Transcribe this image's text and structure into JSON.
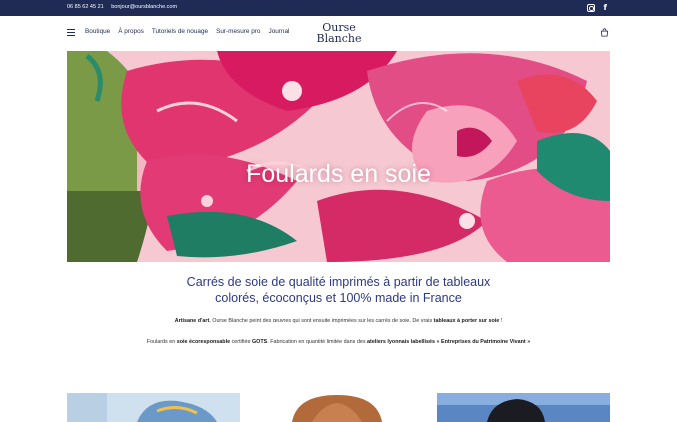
{
  "topbar": {
    "phone": "06 85 62 45 21",
    "email": "bonjour@oursblanche.com",
    "social_icons": [
      "instagram-icon",
      "facebook-icon"
    ],
    "facebook_glyph": "f"
  },
  "nav": {
    "items": [
      "Boutique",
      "À propos",
      "Tutoriels de nouage",
      "Sur-mesure pro",
      "Journal"
    ]
  },
  "logo": {
    "line1": "Ourse",
    "line2": "Blanche"
  },
  "hero": {
    "title": "Foulards en soie"
  },
  "intro": {
    "title_line1": "Carrés de soie de qualité imprimés à partir de tableaux",
    "title_line2": "colorés, écoconçus et 100% made in France",
    "p1_bold1": "Artisane d'art",
    "p1_text1": ", Ourse Blanche peint des œuvres qui sont ensuite imprimées sur les carrés de soie. De vrais ",
    "p1_bold2": "tableaux à porter sur soie",
    "p1_text2": " !",
    "p2_text1": "Foulards en ",
    "p2_bold1": "soie écoresponsable",
    "p2_text2": " certifiée ",
    "p2_bold2": "GOTS",
    "p2_text3": ". Fabrication en quantité limitée dans des ",
    "p2_bold3": "ateliers lyonnais labellisés « Entreprises du Patrimoine Vivant »"
  },
  "colors": {
    "navy": "#1f2a55",
    "accent_blue": "#2b3a85",
    "pink": "#e0356f"
  }
}
